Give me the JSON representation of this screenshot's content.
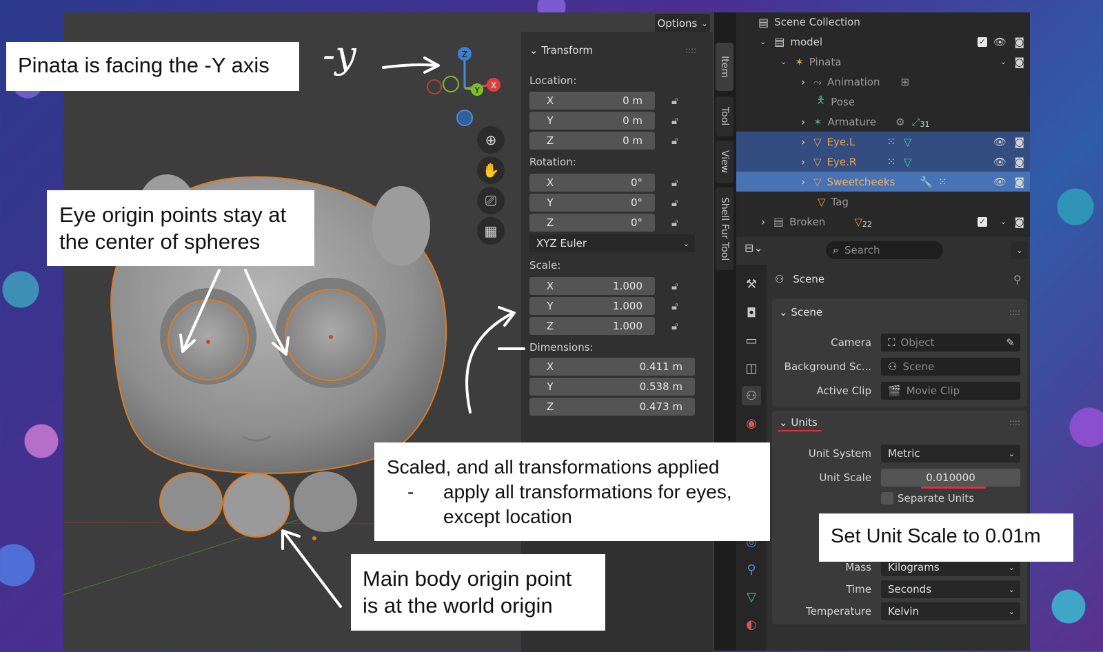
{
  "viewport": {
    "options_label": "Options",
    "gizmo": {
      "z": "Z",
      "y": "Y",
      "x": "X"
    }
  },
  "npanel": {
    "section_title": "Transform",
    "location_label": "Location:",
    "location": [
      {
        "axis": "X",
        "value": "0 m"
      },
      {
        "axis": "Y",
        "value": "0 m"
      },
      {
        "axis": "Z",
        "value": "0 m"
      }
    ],
    "rotation_label": "Rotation:",
    "rotation": [
      {
        "axis": "X",
        "value": "0°"
      },
      {
        "axis": "Y",
        "value": "0°"
      },
      {
        "axis": "Z",
        "value": "0°"
      }
    ],
    "rotation_mode": "XYZ Euler",
    "scale_label": "Scale:",
    "scale": [
      {
        "axis": "X",
        "value": "1.000"
      },
      {
        "axis": "Y",
        "value": "1.000"
      },
      {
        "axis": "Z",
        "value": "1.000"
      }
    ],
    "dimensions_label": "Dimensions:",
    "dimensions": [
      {
        "axis": "X",
        "value": "0.411 m"
      },
      {
        "axis": "Y",
        "value": "0.538 m"
      },
      {
        "axis": "Z",
        "value": "0.473 m"
      }
    ]
  },
  "vertical_tabs": [
    "Item",
    "Tool",
    "View",
    "Shell Fur Tool"
  ],
  "outliner": {
    "root": "Scene Collection",
    "items": [
      {
        "label": "model"
      },
      {
        "label": "Pinata"
      },
      {
        "label": "Animation"
      },
      {
        "label": "Pose"
      },
      {
        "label": "Armature",
        "badge": "31"
      },
      {
        "label": "Eye.L"
      },
      {
        "label": "Eye.R"
      },
      {
        "label": "Sweetcheeks"
      },
      {
        "label": "Tag"
      },
      {
        "label": "Broken",
        "badge": "22"
      }
    ]
  },
  "properties": {
    "search_placeholder": "Search",
    "context_title": "Scene",
    "scene_panel": {
      "title": "Scene",
      "camera_label": "Camera",
      "camera_value": "Object",
      "background_label": "Background Sc...",
      "background_value": "Scene",
      "clip_label": "Active Clip",
      "clip_value": "Movie Clip"
    },
    "units_panel": {
      "title": "Units",
      "system_label": "Unit System",
      "system_value": "Metric",
      "scale_label": "Unit Scale",
      "scale_value": "0.010000",
      "separate_label": "Separate Units",
      "mass_label": "Mass",
      "mass_value": "Kilograms",
      "time_label": "Time",
      "time_value": "Seconds",
      "temp_label": "Temperature",
      "temp_value": "Kelvin"
    }
  },
  "annotations": {
    "facing": "Pinata is facing the -Y axis",
    "minus_y": "-y",
    "eye_origin_line1": "Eye origin points stay at",
    "eye_origin_line2": "the center of spheres",
    "scaled_line1": "Scaled, and all transformations applied",
    "scaled_bullet": "-",
    "scaled_line2": "apply all transformations for eyes,",
    "scaled_line3": "except location",
    "body_origin_line1": "Main body origin point",
    "body_origin_line2": "is at the world origin",
    "unit_scale": "Set Unit Scale to 0.01m"
  },
  "colors": {
    "accent": "#e8a04a",
    "selection": "#334d80",
    "active_selection": "#4772b3",
    "annotation_bg": "#ffffff"
  }
}
